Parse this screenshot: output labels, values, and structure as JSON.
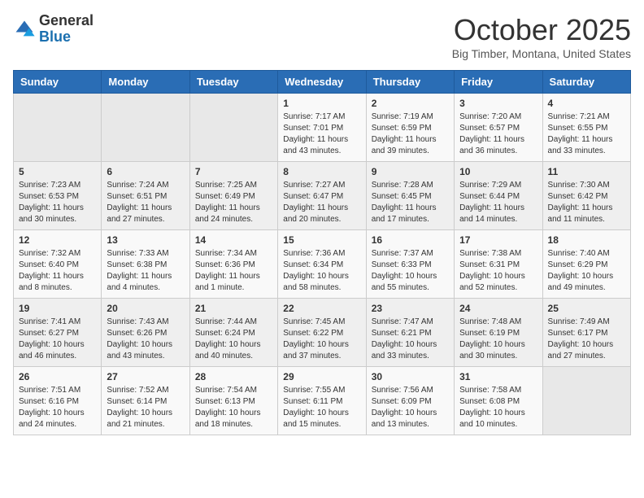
{
  "header": {
    "logo_general": "General",
    "logo_blue": "Blue",
    "month_title": "October 2025",
    "location": "Big Timber, Montana, United States"
  },
  "weekdays": [
    "Sunday",
    "Monday",
    "Tuesday",
    "Wednesday",
    "Thursday",
    "Friday",
    "Saturday"
  ],
  "weeks": [
    [
      {
        "day": "",
        "info": ""
      },
      {
        "day": "",
        "info": ""
      },
      {
        "day": "",
        "info": ""
      },
      {
        "day": "1",
        "info": "Sunrise: 7:17 AM\nSunset: 7:01 PM\nDaylight: 11 hours and 43 minutes."
      },
      {
        "day": "2",
        "info": "Sunrise: 7:19 AM\nSunset: 6:59 PM\nDaylight: 11 hours and 39 minutes."
      },
      {
        "day": "3",
        "info": "Sunrise: 7:20 AM\nSunset: 6:57 PM\nDaylight: 11 hours and 36 minutes."
      },
      {
        "day": "4",
        "info": "Sunrise: 7:21 AM\nSunset: 6:55 PM\nDaylight: 11 hours and 33 minutes."
      }
    ],
    [
      {
        "day": "5",
        "info": "Sunrise: 7:23 AM\nSunset: 6:53 PM\nDaylight: 11 hours and 30 minutes."
      },
      {
        "day": "6",
        "info": "Sunrise: 7:24 AM\nSunset: 6:51 PM\nDaylight: 11 hours and 27 minutes."
      },
      {
        "day": "7",
        "info": "Sunrise: 7:25 AM\nSunset: 6:49 PM\nDaylight: 11 hours and 24 minutes."
      },
      {
        "day": "8",
        "info": "Sunrise: 7:27 AM\nSunset: 6:47 PM\nDaylight: 11 hours and 20 minutes."
      },
      {
        "day": "9",
        "info": "Sunrise: 7:28 AM\nSunset: 6:45 PM\nDaylight: 11 hours and 17 minutes."
      },
      {
        "day": "10",
        "info": "Sunrise: 7:29 AM\nSunset: 6:44 PM\nDaylight: 11 hours and 14 minutes."
      },
      {
        "day": "11",
        "info": "Sunrise: 7:30 AM\nSunset: 6:42 PM\nDaylight: 11 hours and 11 minutes."
      }
    ],
    [
      {
        "day": "12",
        "info": "Sunrise: 7:32 AM\nSunset: 6:40 PM\nDaylight: 11 hours and 8 minutes."
      },
      {
        "day": "13",
        "info": "Sunrise: 7:33 AM\nSunset: 6:38 PM\nDaylight: 11 hours and 4 minutes."
      },
      {
        "day": "14",
        "info": "Sunrise: 7:34 AM\nSunset: 6:36 PM\nDaylight: 11 hours and 1 minute."
      },
      {
        "day": "15",
        "info": "Sunrise: 7:36 AM\nSunset: 6:34 PM\nDaylight: 10 hours and 58 minutes."
      },
      {
        "day": "16",
        "info": "Sunrise: 7:37 AM\nSunset: 6:33 PM\nDaylight: 10 hours and 55 minutes."
      },
      {
        "day": "17",
        "info": "Sunrise: 7:38 AM\nSunset: 6:31 PM\nDaylight: 10 hours and 52 minutes."
      },
      {
        "day": "18",
        "info": "Sunrise: 7:40 AM\nSunset: 6:29 PM\nDaylight: 10 hours and 49 minutes."
      }
    ],
    [
      {
        "day": "19",
        "info": "Sunrise: 7:41 AM\nSunset: 6:27 PM\nDaylight: 10 hours and 46 minutes."
      },
      {
        "day": "20",
        "info": "Sunrise: 7:43 AM\nSunset: 6:26 PM\nDaylight: 10 hours and 43 minutes."
      },
      {
        "day": "21",
        "info": "Sunrise: 7:44 AM\nSunset: 6:24 PM\nDaylight: 10 hours and 40 minutes."
      },
      {
        "day": "22",
        "info": "Sunrise: 7:45 AM\nSunset: 6:22 PM\nDaylight: 10 hours and 37 minutes."
      },
      {
        "day": "23",
        "info": "Sunrise: 7:47 AM\nSunset: 6:21 PM\nDaylight: 10 hours and 33 minutes."
      },
      {
        "day": "24",
        "info": "Sunrise: 7:48 AM\nSunset: 6:19 PM\nDaylight: 10 hours and 30 minutes."
      },
      {
        "day": "25",
        "info": "Sunrise: 7:49 AM\nSunset: 6:17 PM\nDaylight: 10 hours and 27 minutes."
      }
    ],
    [
      {
        "day": "26",
        "info": "Sunrise: 7:51 AM\nSunset: 6:16 PM\nDaylight: 10 hours and 24 minutes."
      },
      {
        "day": "27",
        "info": "Sunrise: 7:52 AM\nSunset: 6:14 PM\nDaylight: 10 hours and 21 minutes."
      },
      {
        "day": "28",
        "info": "Sunrise: 7:54 AM\nSunset: 6:13 PM\nDaylight: 10 hours and 18 minutes."
      },
      {
        "day": "29",
        "info": "Sunrise: 7:55 AM\nSunset: 6:11 PM\nDaylight: 10 hours and 15 minutes."
      },
      {
        "day": "30",
        "info": "Sunrise: 7:56 AM\nSunset: 6:09 PM\nDaylight: 10 hours and 13 minutes."
      },
      {
        "day": "31",
        "info": "Sunrise: 7:58 AM\nSunset: 6:08 PM\nDaylight: 10 hours and 10 minutes."
      },
      {
        "day": "",
        "info": ""
      }
    ]
  ]
}
